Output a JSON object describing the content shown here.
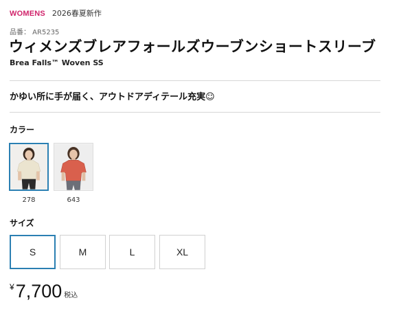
{
  "header": {
    "category": "WOMENS",
    "season": "2026春夏新作",
    "product_number": "品番： AR5235",
    "title": "ウィメンズブレアフォールズウーブンショートスリーブ",
    "subtitle": "Brea Falls™ Woven SS"
  },
  "catch_copy": "かゆい所に手が届く、アウトドアディテール充実☺",
  "colors": {
    "label": "カラー",
    "items": [
      {
        "code": "278",
        "swatch": "#efe9d8",
        "selected": true
      },
      {
        "code": "643",
        "swatch": "#d9604d",
        "selected": false
      }
    ]
  },
  "sizes": {
    "label": "サイズ",
    "items": [
      "S",
      "M",
      "L",
      "XL"
    ],
    "selected": "S"
  },
  "price": {
    "currency": "¥",
    "amount": "7,700",
    "tax_label": "税込"
  },
  "theme": {
    "accent_pink": "#d0246b",
    "selected_border": "#2a7fb2"
  }
}
